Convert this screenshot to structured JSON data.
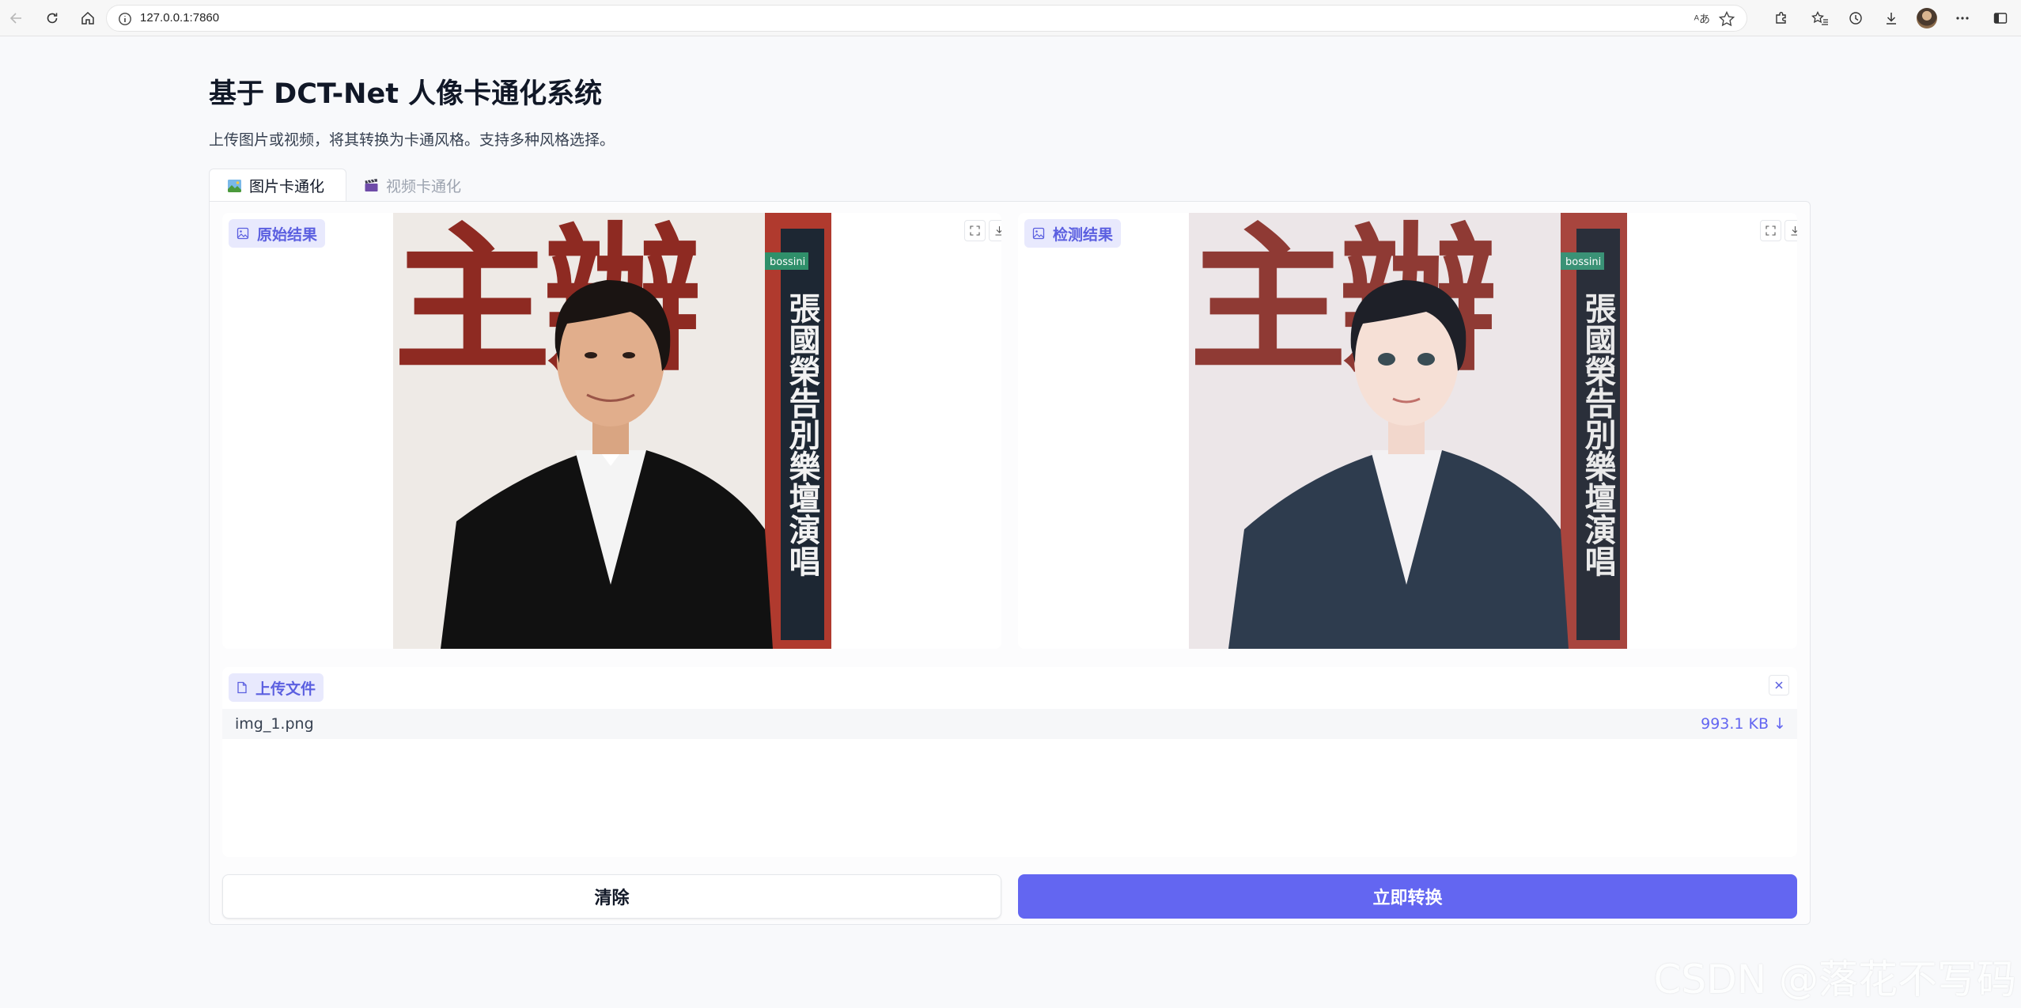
{
  "browser": {
    "url": "127.0.0.1:7860",
    "translate_glyph": "ᴬあ"
  },
  "page": {
    "title": "基于 DCT-Net 人像卡通化系统",
    "description": "上传图片或视频，将其转换为卡通风格。支持多种风格选择。"
  },
  "tabs": [
    {
      "label": "图片卡通化",
      "icon": "picture-icon",
      "active": true
    },
    {
      "label": "视频卡通化",
      "icon": "clapperboard-icon",
      "active": false
    }
  ],
  "blocks": {
    "original": {
      "label": "原始结果"
    },
    "detected": {
      "label": "检测结果"
    }
  },
  "upload": {
    "label": "上传文件",
    "file_name": "img_1.png",
    "file_size": "993.1 KB ↓"
  },
  "buttons": {
    "clear": "清除",
    "convert": "立即转换"
  },
  "photo_text": {
    "chars_top": "主 辦",
    "vertical": "張國榮告別樂壇演唱",
    "brand": "bossini"
  },
  "watermark": "CSDN @落花不写码",
  "colors": {
    "accent": "#6366f1",
    "label_bg": "#e8e9fd"
  }
}
